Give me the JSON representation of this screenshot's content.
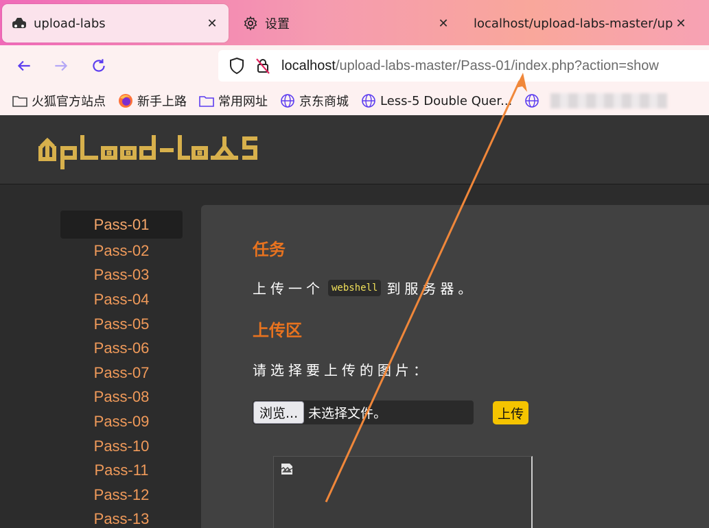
{
  "tabs": [
    {
      "title": "upload-labs",
      "icon": "car-icon"
    },
    {
      "title": "设置",
      "icon": "gear-icon"
    },
    {
      "title": "localhost/upload-labs-master/up",
      "icon": "none"
    }
  ],
  "address": {
    "host": "localhost",
    "path": "/upload-labs-master/Pass-01/index.php?action=show"
  },
  "bookmarks": [
    {
      "label": "火狐官方站点",
      "icon": "folder-icon"
    },
    {
      "label": "新手上路",
      "icon": "firefox-icon"
    },
    {
      "label": "常用网址",
      "icon": "folder-icon"
    },
    {
      "label": "京东商城",
      "icon": "globe-icon"
    },
    {
      "label": "Less-5 Double Quer...",
      "icon": "globe-icon"
    }
  ],
  "logo": {
    "text": "Upload-labs",
    "color": "#d7b04c"
  },
  "sidebar": {
    "items": [
      "Pass-01",
      "Pass-02",
      "Pass-03",
      "Pass-04",
      "Pass-05",
      "Pass-06",
      "Pass-07",
      "Pass-08",
      "Pass-09",
      "Pass-10",
      "Pass-11",
      "Pass-12",
      "Pass-13"
    ],
    "active": "Pass-01"
  },
  "task": {
    "heading": "任务",
    "text_before": "上传一个",
    "code": "webshell",
    "text_after": "到服务器。"
  },
  "upload": {
    "heading": "上传区",
    "prompt": "请选择要上传的图片：",
    "browse_label": "浏览...",
    "no_file": "未选择文件。",
    "submit_label": "上传"
  },
  "colors": {
    "accent": "#e8731f",
    "sidebar_link": "#f09a5a",
    "submit": "#f5c400"
  }
}
